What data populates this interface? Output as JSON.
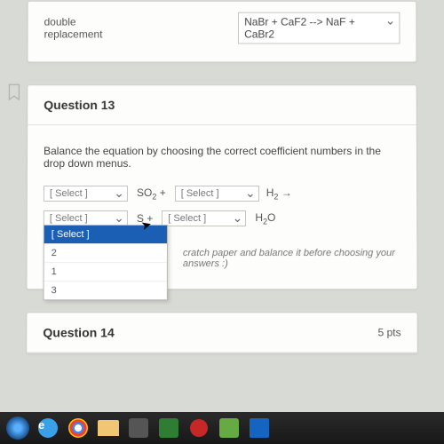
{
  "q12": {
    "answer_label": "double replacement",
    "dropdown_value": "NaBr + CaF2 --> NaF + CaBr2"
  },
  "q13": {
    "title": "Question 13",
    "instruction": "Balance the equation by choosing the correct coefficient numbers in the drop down menus.",
    "select_placeholder": "[ Select ]",
    "row1": {
      "chem1": "SO₂ +",
      "chem2": "H₂ →"
    },
    "row2": {
      "chem1": "S +",
      "chem2": "H₂O"
    },
    "dropdown": {
      "selected": "[ Select ]",
      "opt1": "2",
      "opt2": "1",
      "opt3": "3"
    },
    "hint": "cratch paper and balance it before choosing your answers :)"
  },
  "q14": {
    "title": "Question 14",
    "pts": "5 pts"
  }
}
